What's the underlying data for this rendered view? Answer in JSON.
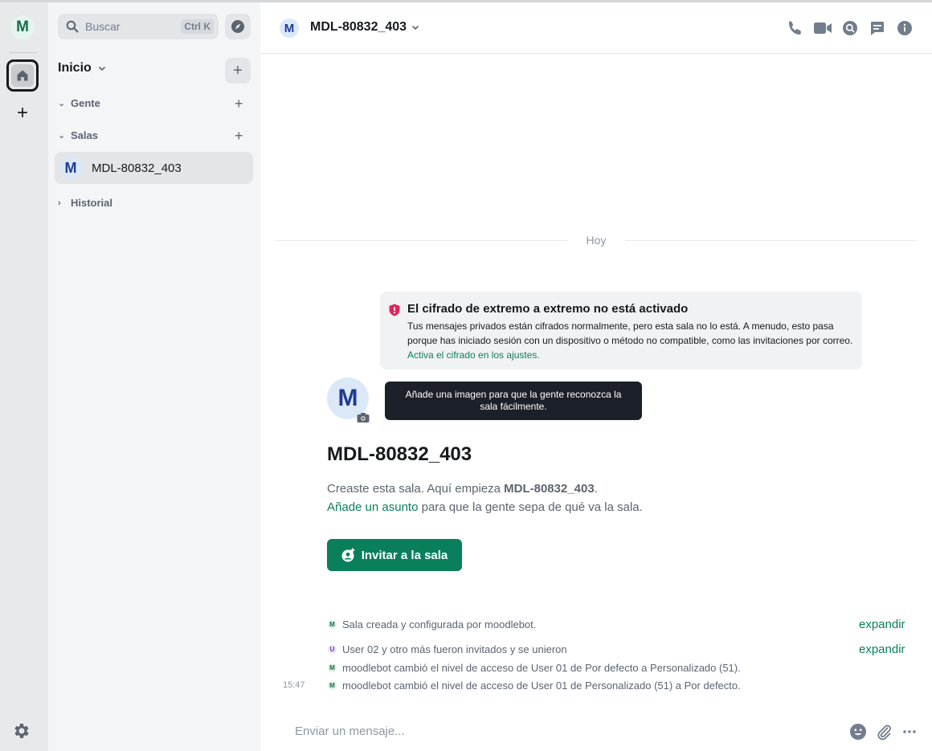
{
  "spacebar": {
    "avatar_letter": "M",
    "add_label": "+"
  },
  "roomlist": {
    "search_placeholder": "Buscar",
    "search_shortcut": "Ctrl K",
    "home_title": "Inicio",
    "sections": [
      {
        "label": "Gente"
      },
      {
        "label": "Salas"
      },
      {
        "label": "Historial"
      }
    ],
    "rooms": [
      {
        "avatar_letter": "M",
        "name": "MDL-80832_403"
      }
    ]
  },
  "header": {
    "avatar_letter": "M",
    "room_name": "MDL-80832_403",
    "icons": [
      "phone-icon",
      "video-icon",
      "search-icon",
      "threads-icon",
      "info-icon"
    ]
  },
  "timeline": {
    "date_separator": "Hoy",
    "e2e": {
      "title": "El cifrado de extremo a extremo no está activado",
      "body": "Tus mensajes privados están cifrados normalmente, pero esta sala no lo está. A menudo, esto pasa porque has iniciado sesión con un dispositivo o método no compatible, como las invitaciones por correo.",
      "link": "Activa el cifrado en los ajustes."
    },
    "big_avatar_letter": "M",
    "tooltip": "Añade una imagen para que la gente reconozca la sala fácilmente.",
    "room_heading": "MDL-80832_403",
    "intro_prefix": "Creaste esta sala. Aquí empieza ",
    "intro_room": "MDL-80832_403",
    "intro_suffix": ".",
    "topic_link": "Añade un asunto",
    "topic_rest": " para que la gente sepa de qué va la sala.",
    "invite_label": "Invitar a la sala",
    "events": [
      {
        "avatar": "M",
        "text": "Sala creada y configurada por moodlebot.",
        "expand": "expandir"
      },
      {
        "avatar": "U",
        "text": "User 02 y otro más fueron invitados y se unieron",
        "expand": "expandir"
      },
      {
        "avatar": "M",
        "text": "moodlebot cambió el nivel de acceso de User 01 de Por defecto a Personalizado (51)."
      },
      {
        "avatar": "M",
        "text": "moodlebot cambió el nivel de acceso de User 01 de Personalizado (51) a Por defecto.",
        "timestamp": "15:47"
      }
    ]
  },
  "composer": {
    "placeholder": "Enviar un mensaje..."
  },
  "colors": {
    "accent": "#0a7f5c",
    "tooltip_bg": "#1c2028",
    "warning_red": "#e0245e"
  }
}
